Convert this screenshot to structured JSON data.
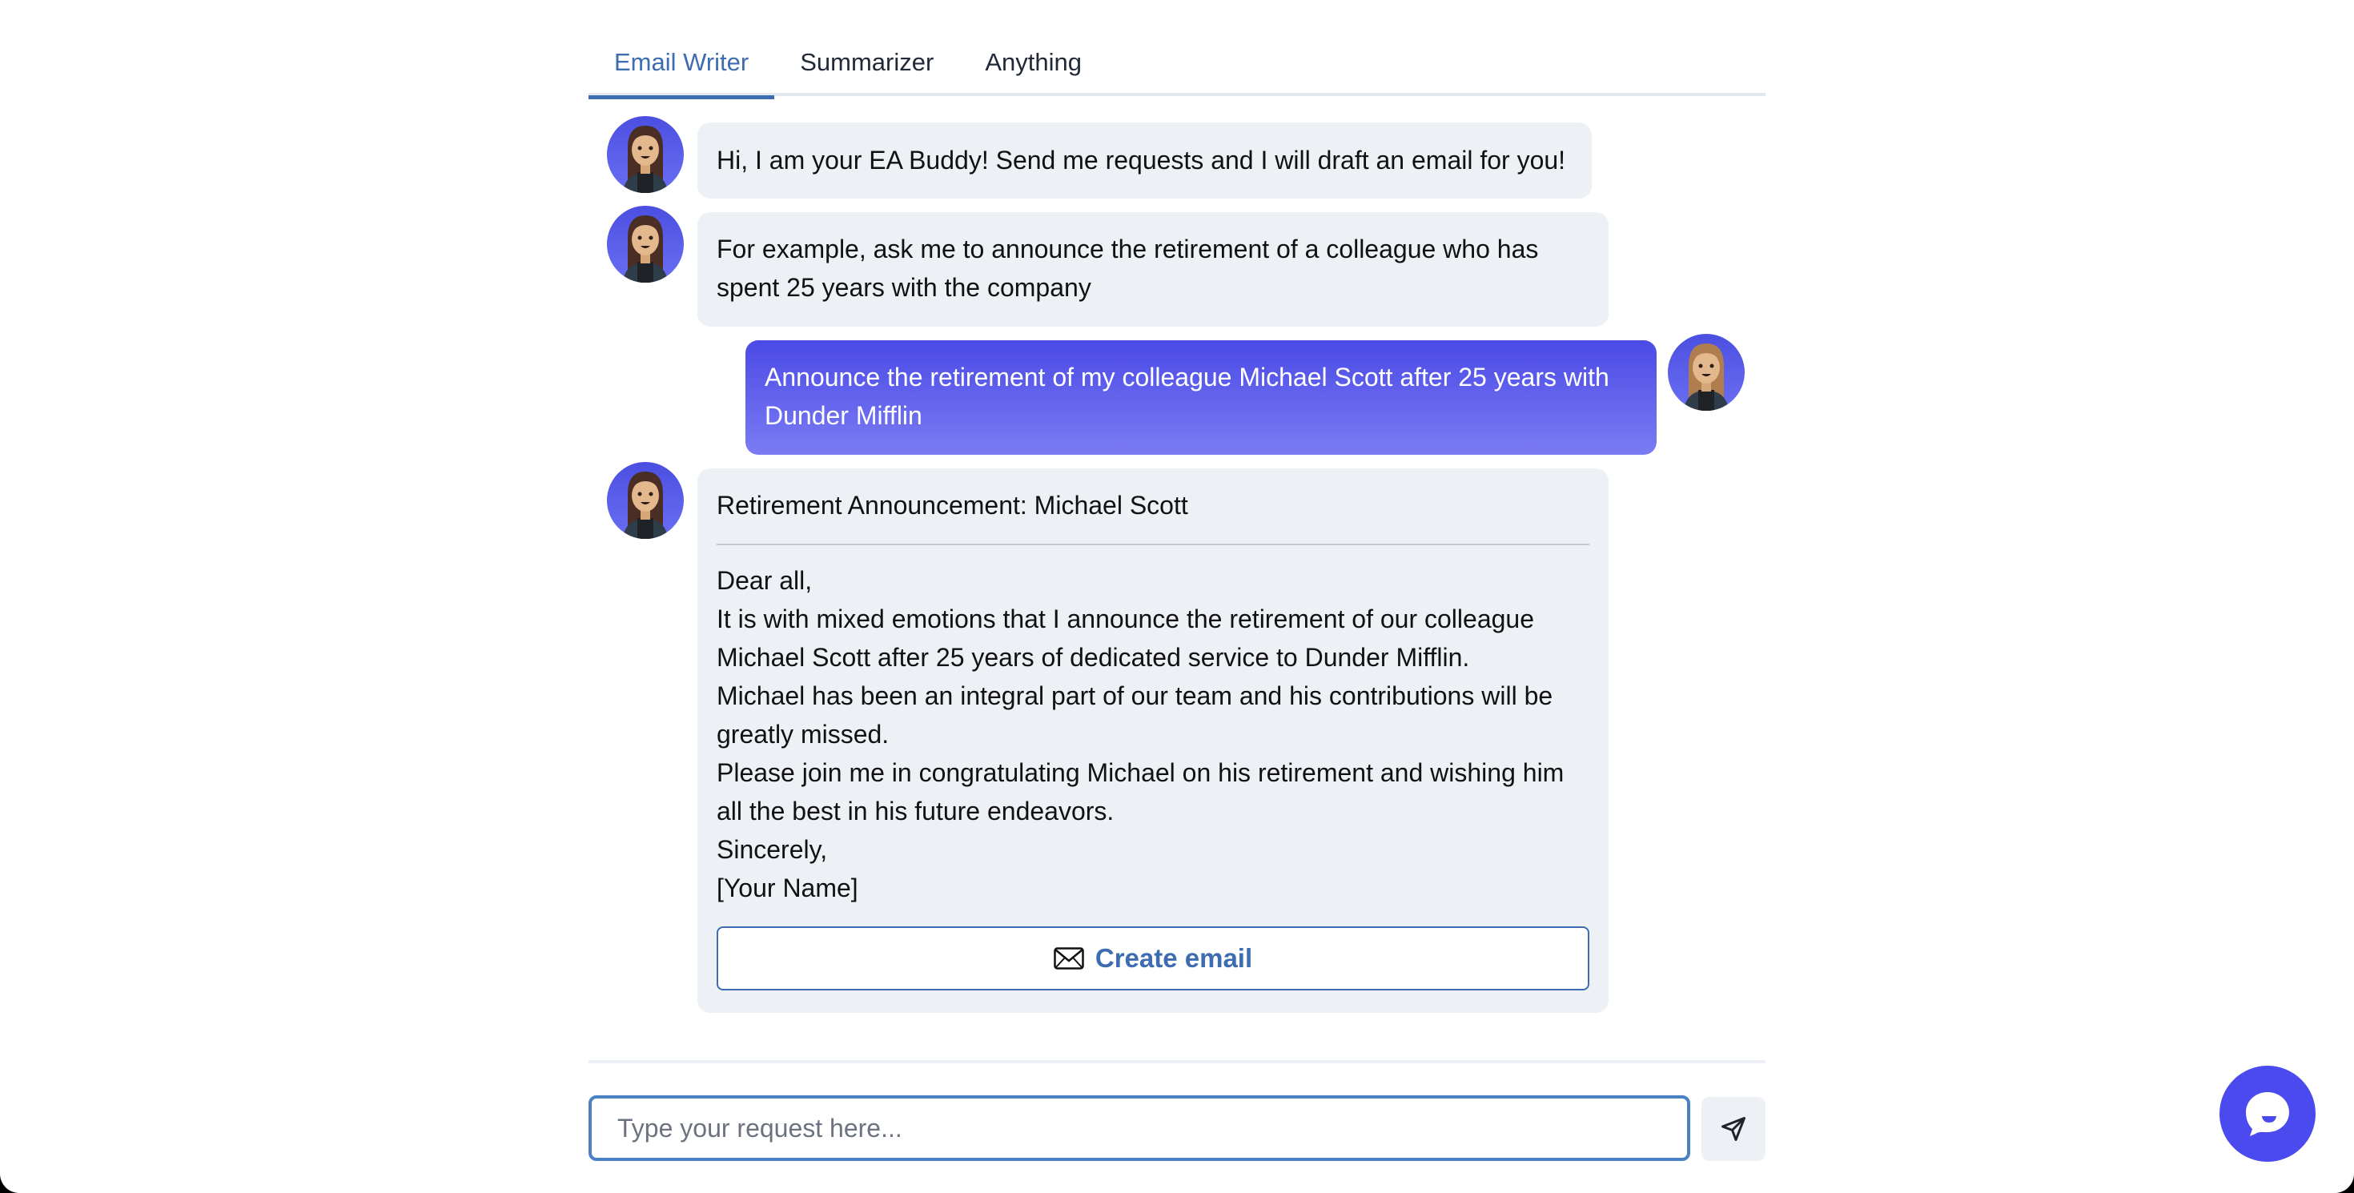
{
  "tabs": [
    {
      "label": "Email Writer",
      "active": true
    },
    {
      "label": "Summarizer",
      "active": false
    },
    {
      "label": "Anything",
      "active": false
    }
  ],
  "messages": [
    {
      "role": "assistant",
      "avatar": "assistant-avatar",
      "text": "Hi, I am your EA Buddy! Send me requests and I will draft an email for you!"
    },
    {
      "role": "assistant",
      "avatar": "assistant-avatar",
      "text": "For example, ask me to announce the retirement of a colleague who has spent 25 years with the company"
    },
    {
      "role": "user",
      "avatar": "user-avatar",
      "text": "Announce the retirement of my colleague Michael Scott after 25 years with Dunder Mifflin"
    },
    {
      "role": "assistant",
      "avatar": "assistant-avatar",
      "email": {
        "subject": "Retirement Announcement: Michael Scott",
        "body": [
          "Dear all,",
          "It is with mixed emotions that I announce the retirement of our colleague Michael Scott after 25 years of dedicated service to Dunder Mifflin.",
          "Michael has been an integral part of our team and his contributions will be greatly missed.",
          "Please join me in congratulating Michael on his retirement and wishing him all the best in his future endeavors.",
          "Sincerely,",
          "[Your Name]"
        ],
        "button_label": "Create email",
        "button_icon": "envelope-icon"
      }
    }
  ],
  "input": {
    "placeholder": "Type your request here...",
    "value": "",
    "send_icon": "send-icon"
  },
  "chat_widget": {
    "icon": "chat-bubble-icon"
  },
  "colors": {
    "accent": "#3d6cb0",
    "user_bubble_top": "#4a4ae6",
    "user_bubble_bottom": "#7b7cf3",
    "assistant_bubble": "#edf0f5",
    "widget": "#4a4aee"
  }
}
